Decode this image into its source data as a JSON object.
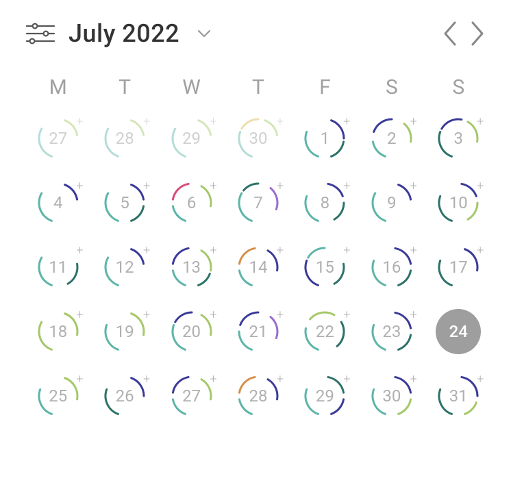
{
  "header": {
    "title": "July 2022"
  },
  "weekdays": [
    "M",
    "T",
    "W",
    "T",
    "F",
    "S",
    "S"
  ],
  "colors": {
    "teal": "#5db5a8",
    "green": "#a4c86a",
    "yellow": "#d4b94a",
    "orange": "#d68f4a",
    "pink": "#d84a78",
    "purple": "#9a6dd0",
    "navy": "#3a3a9a",
    "blue": "#4a7ad6",
    "dteal": "#2d7268"
  },
  "days": [
    {
      "num": "27",
      "outside": true,
      "selected": false,
      "arcs": [
        [
          "teal",
          200,
          300
        ],
        [
          "green",
          20,
          80
        ]
      ]
    },
    {
      "num": "28",
      "outside": true,
      "selected": false,
      "arcs": [
        [
          "teal",
          200,
          300
        ],
        [
          "green",
          20,
          80
        ]
      ]
    },
    {
      "num": "29",
      "outside": true,
      "selected": false,
      "arcs": [
        [
          "teal",
          200,
          300
        ],
        [
          "green",
          20,
          80
        ]
      ]
    },
    {
      "num": "30",
      "outside": true,
      "selected": false,
      "arcs": [
        [
          "teal",
          200,
          290
        ],
        [
          "yellow",
          300,
          360
        ],
        [
          "green",
          20,
          80
        ]
      ]
    },
    {
      "num": "1",
      "outside": false,
      "selected": false,
      "arcs": [
        [
          "teal",
          200,
          290
        ],
        [
          "navy",
          20,
          90
        ],
        [
          "dteal",
          100,
          160
        ]
      ]
    },
    {
      "num": "2",
      "outside": false,
      "selected": false,
      "arcs": [
        [
          "teal",
          200,
          260
        ],
        [
          "navy",
          290,
          360
        ],
        [
          "green",
          40,
          100
        ]
      ]
    },
    {
      "num": "3",
      "outside": false,
      "selected": false,
      "arcs": [
        [
          "dteal",
          200,
          290
        ],
        [
          "navy",
          300,
          10
        ],
        [
          "green",
          30,
          100
        ]
      ]
    },
    {
      "num": "4",
      "outside": false,
      "selected": false,
      "arcs": [
        [
          "teal",
          200,
          300
        ],
        [
          "navy",
          20,
          80
        ]
      ]
    },
    {
      "num": "5",
      "outside": false,
      "selected": false,
      "arcs": [
        [
          "teal",
          200,
          300
        ],
        [
          "navy",
          20,
          80
        ],
        [
          "dteal",
          100,
          160
        ]
      ]
    },
    {
      "num": "6",
      "outside": false,
      "selected": false,
      "arcs": [
        [
          "teal",
          200,
          260
        ],
        [
          "pink",
          280,
          350
        ],
        [
          "green",
          30,
          100
        ]
      ]
    },
    {
      "num": "7",
      "outside": false,
      "selected": false,
      "arcs": [
        [
          "teal",
          200,
          300
        ],
        [
          "purple",
          40,
          110
        ],
        [
          "dteal",
          310,
          360
        ]
      ]
    },
    {
      "num": "8",
      "outside": false,
      "selected": false,
      "arcs": [
        [
          "teal",
          200,
          290
        ],
        [
          "navy",
          10,
          70
        ],
        [
          "dteal",
          90,
          150
        ]
      ]
    },
    {
      "num": "9",
      "outside": false,
      "selected": false,
      "arcs": [
        [
          "teal",
          200,
          300
        ],
        [
          "navy",
          20,
          80
        ]
      ]
    },
    {
      "num": "10",
      "outside": false,
      "selected": false,
      "arcs": [
        [
          "dteal",
          200,
          290
        ],
        [
          "navy",
          10,
          70
        ],
        [
          "green",
          90,
          150
        ]
      ]
    },
    {
      "num": "11",
      "outside": false,
      "selected": false,
      "arcs": [
        [
          "teal",
          200,
          300
        ],
        [
          "dteal",
          80,
          150
        ]
      ]
    },
    {
      "num": "12",
      "outside": false,
      "selected": false,
      "arcs": [
        [
          "teal",
          200,
          300
        ],
        [
          "navy",
          20,
          80
        ]
      ]
    },
    {
      "num": "13",
      "outside": false,
      "selected": false,
      "arcs": [
        [
          "teal",
          200,
          260
        ],
        [
          "navy",
          280,
          350
        ],
        [
          "green",
          30,
          100
        ],
        [
          "dteal",
          110,
          160
        ]
      ]
    },
    {
      "num": "14",
      "outside": false,
      "selected": false,
      "arcs": [
        [
          "teal",
          200,
          260
        ],
        [
          "orange",
          280,
          350
        ],
        [
          "navy",
          30,
          100
        ]
      ]
    },
    {
      "num": "15",
      "outside": false,
      "selected": false,
      "arcs": [
        [
          "navy",
          200,
          290
        ],
        [
          "teal",
          300,
          360
        ],
        [
          "dteal",
          80,
          150
        ]
      ]
    },
    {
      "num": "16",
      "outside": false,
      "selected": false,
      "arcs": [
        [
          "teal",
          200,
          290
        ],
        [
          "navy",
          10,
          80
        ],
        [
          "dteal",
          100,
          160
        ]
      ]
    },
    {
      "num": "17",
      "outside": false,
      "selected": false,
      "arcs": [
        [
          "dteal",
          200,
          290
        ],
        [
          "navy",
          20,
          100
        ]
      ]
    },
    {
      "num": "18",
      "outside": false,
      "selected": false,
      "arcs": [
        [
          "green",
          200,
          300
        ],
        [
          "green",
          20,
          100
        ]
      ]
    },
    {
      "num": "19",
      "outside": false,
      "selected": false,
      "arcs": [
        [
          "teal",
          200,
          290
        ],
        [
          "green",
          20,
          100
        ]
      ]
    },
    {
      "num": "20",
      "outside": false,
      "selected": false,
      "arcs": [
        [
          "teal",
          200,
          290
        ],
        [
          "navy",
          300,
          360
        ],
        [
          "green",
          30,
          100
        ]
      ]
    },
    {
      "num": "21",
      "outside": false,
      "selected": false,
      "arcs": [
        [
          "teal",
          200,
          270
        ],
        [
          "navy",
          290,
          360
        ],
        [
          "purple",
          40,
          110
        ]
      ]
    },
    {
      "num": "22",
      "outside": false,
      "selected": false,
      "arcs": [
        [
          "teal",
          200,
          280
        ],
        [
          "green",
          310,
          30
        ],
        [
          "dteal",
          60,
          140
        ]
      ]
    },
    {
      "num": "23",
      "outside": false,
      "selected": false,
      "arcs": [
        [
          "teal",
          200,
          290
        ],
        [
          "navy",
          10,
          80
        ],
        [
          "dteal",
          100,
          160
        ]
      ]
    },
    {
      "num": "24",
      "outside": false,
      "selected": true,
      "arcs": []
    },
    {
      "num": "25",
      "outside": false,
      "selected": false,
      "arcs": [
        [
          "teal",
          200,
          290
        ],
        [
          "green",
          20,
          100
        ]
      ]
    },
    {
      "num": "26",
      "outside": false,
      "selected": false,
      "arcs": [
        [
          "dteal",
          200,
          290
        ],
        [
          "navy",
          20,
          90
        ]
      ]
    },
    {
      "num": "27",
      "outside": false,
      "selected": false,
      "arcs": [
        [
          "teal",
          200,
          260
        ],
        [
          "navy",
          280,
          350
        ],
        [
          "green",
          30,
          100
        ]
      ]
    },
    {
      "num": "28",
      "outside": false,
      "selected": false,
      "arcs": [
        [
          "teal",
          200,
          260
        ],
        [
          "orange",
          280,
          350
        ],
        [
          "navy",
          30,
          100
        ]
      ]
    },
    {
      "num": "29",
      "outside": false,
      "selected": false,
      "arcs": [
        [
          "teal",
          200,
          290
        ],
        [
          "dteal",
          10,
          80
        ],
        [
          "navy",
          100,
          160
        ]
      ]
    },
    {
      "num": "30",
      "outside": false,
      "selected": false,
      "arcs": [
        [
          "teal",
          200,
          290
        ],
        [
          "navy",
          10,
          80
        ],
        [
          "green",
          100,
          160
        ]
      ]
    },
    {
      "num": "31",
      "outside": false,
      "selected": false,
      "arcs": [
        [
          "dteal",
          200,
          290
        ],
        [
          "navy",
          10,
          90
        ],
        [
          "green",
          110,
          160
        ]
      ]
    }
  ]
}
